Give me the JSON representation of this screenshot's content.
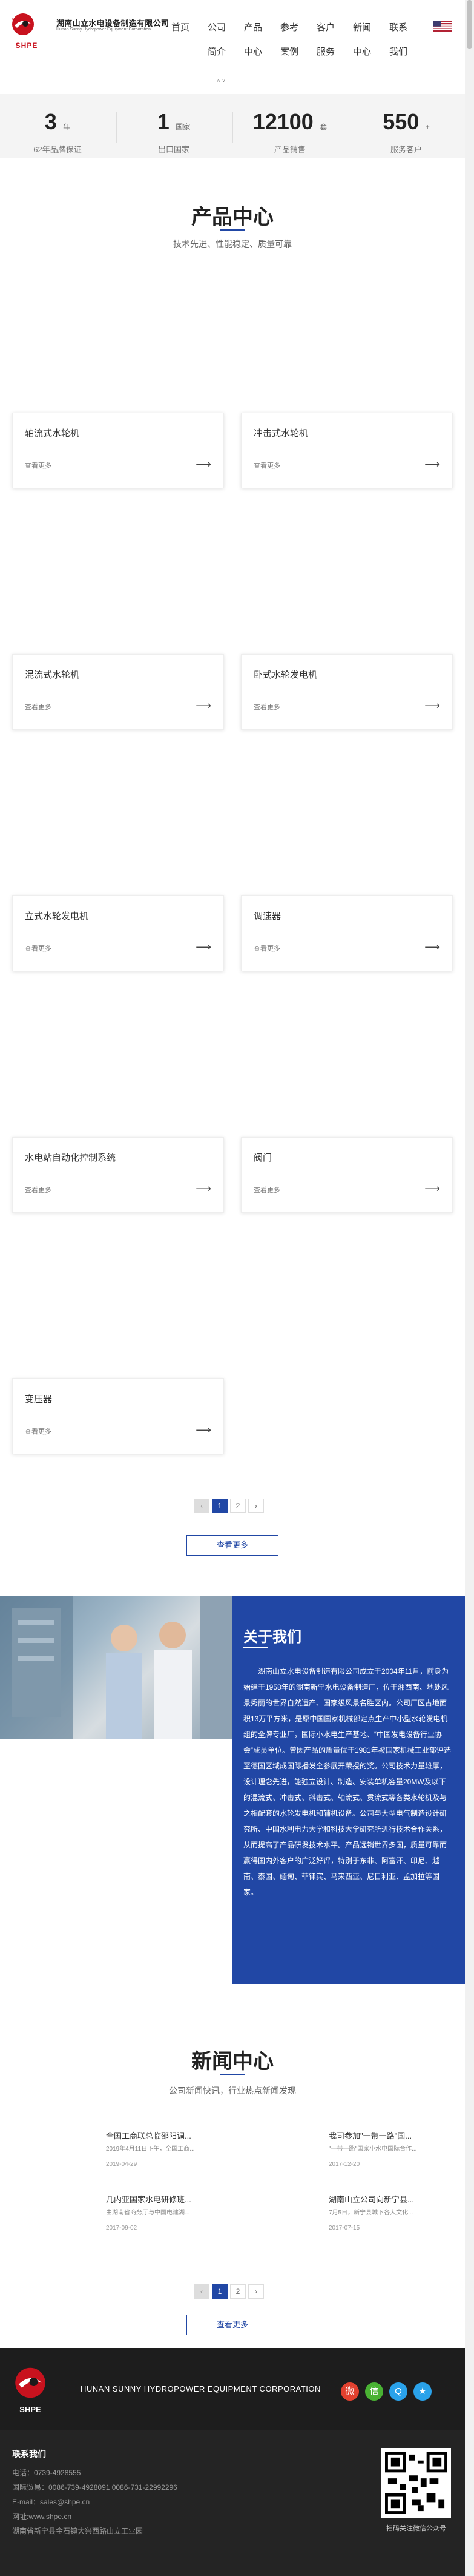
{
  "header": {
    "logo_text": "SHPE",
    "company_cn": "湖南山立水电设备制造有限公司",
    "company_en": "Hunan Sunny Hydropower Equipment Corporation",
    "nav": [
      {
        "label": "首页"
      },
      {
        "label": "公司"
      },
      {
        "label": "产品"
      },
      {
        "label": "参考"
      },
      {
        "label": "客户"
      },
      {
        "label": "新闻"
      },
      {
        "label": "联系"
      }
    ],
    "nav_row2": [
      {
        "label": "简介"
      },
      {
        "label": "中心"
      },
      {
        "label": "案例"
      },
      {
        "label": "服务"
      },
      {
        "label": "中心"
      },
      {
        "label": "我们"
      }
    ],
    "nav_arrow": "˄ ˅"
  },
  "stats": [
    {
      "num": "3",
      "unit": "年",
      "label": "62年品牌保证"
    },
    {
      "num": "1",
      "unit": "国家",
      "label": "出口国家"
    },
    {
      "num": "12100",
      "unit": "套",
      "label": "产品销售"
    },
    {
      "num": "550",
      "unit": "+",
      "label": "服务客户"
    }
  ],
  "products_section": {
    "title": "产品中心",
    "subtitle": "技术先进、性能稳定、质量可靠",
    "more_label": "查看更多",
    "arrow": "⟶",
    "items": [
      {
        "name": "轴流式水轮机"
      },
      {
        "name": "冲击式水轮机"
      },
      {
        "name": "混流式水轮机"
      },
      {
        "name": "卧式水轮发电机"
      },
      {
        "name": "立式水轮发电机"
      },
      {
        "name": "调速器"
      },
      {
        "name": "水电站自动化控制系统"
      },
      {
        "name": "阀门"
      },
      {
        "name": "变压器"
      }
    ],
    "pager": {
      "prev": "‹",
      "pages": [
        "1",
        "2"
      ],
      "next": "›"
    },
    "more_button": "查看更多"
  },
  "about": {
    "title": "关于我们",
    "text": "湖南山立水电设备制造有限公司成立于2004年11月，前身为始建于1958年的湖南新宁水电设备制造厂，位于湘西南、地处风景秀丽的世界自然遗产、国家级风景名胜区内。公司厂区占地面积13万平方米，是原中国国家机械部定点生产中小型水轮发电机组的全牌专业厂，国际小水电生产基地、“中国发电设备行业协会”成员单位。曾因产品的质量优于1981年被国家机械工业部评选至德国区域成国际播发全参展开荣授的奖。公司技术力量雄厚，设计理念先进，能独立设计、制造、安装单机容量20MW及以下的混流式、冲击式、斜击式、轴流式、贯流式等各类水轮机及与之相配套的水轮发电机和辅机设备。公司与大型电气制造设计研究所、中国水利电力大学和科技大学研究所进行技术合作关系，从而提高了产品研发技术水平。产品远销世界多国，质量可靠而赢得国内外客户的广泛好评，特别于东非、阿富汗、印尼、越南、泰国、缅甸、菲律宾、马来西亚、尼日利亚、孟加拉等国家。"
  },
  "news": {
    "title": "新闻中心",
    "subtitle": "公司新闻快讯，行业热点新闻发现",
    "items": [
      {
        "title": "全国工商联总临邵阳调...",
        "desc": "2019年4月11日下午，全国工商...",
        "date": "2019-04-29"
      },
      {
        "title": "我司参加\"一带一路\"国...",
        "desc": "\"一带一路\"国家小水电国际合作...",
        "date": "2017-12-20"
      },
      {
        "title": "几内亚国家水电研修班...",
        "desc": "由湖南省商务厅与中国电建湖...",
        "date": "2017-09-02"
      },
      {
        "title": "湖南山立公司向新宁县...",
        "desc": "7月5日，新宁县城下各大文化...",
        "date": "2017-07-15"
      }
    ],
    "pager": {
      "prev": "‹",
      "pages": [
        "1",
        "2"
      ],
      "next": "›"
    },
    "more_button": "查看更多"
  },
  "footer": {
    "logo_text": "SHPE",
    "company_en": "HUNAN SUNNY HYDROPOWER EQUIPMENT CORPORATION",
    "contact_title": "联系我们",
    "contacts": [
      "电话：0739-4928555",
      "国际贸易：0086-739-4928091    0086-731-22992296",
      "E-mail：sales@shpe.cn",
      "网址:www.shpe.cn",
      "湖南省新宁县金石镇大兴西路山立工业园"
    ],
    "qr_caption": "扫码关注微信公众号",
    "social": [
      {
        "icon": "weibo-icon",
        "glyph": "微",
        "color": "#e2412f"
      },
      {
        "icon": "wechat-icon",
        "glyph": "信",
        "color": "#49b233"
      },
      {
        "icon": "qq-icon",
        "glyph": "Q",
        "color": "#2aa2ea"
      },
      {
        "icon": "favorite-icon",
        "glyph": "★",
        "color": "#2aa2ea"
      }
    ]
  }
}
